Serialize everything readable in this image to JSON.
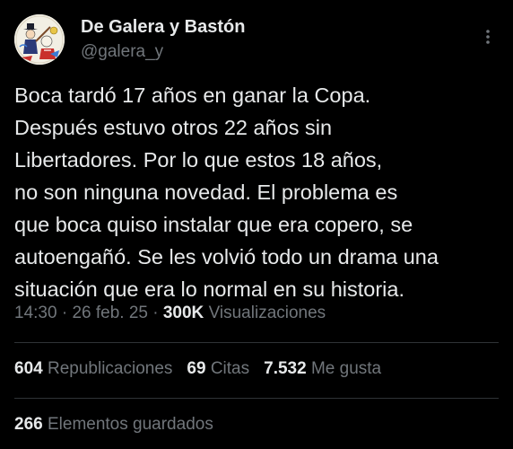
{
  "author": {
    "display_name": "De Galera y Bastón",
    "handle": "@galera_y",
    "avatar_icon": "cartoon-avatar-icon"
  },
  "more_icon": "more-vertical-icon",
  "tweet": {
    "lines": [
      "Boca tardó 17 años en ganar la Copa.",
      "Después estuvo otros 22 años sin",
      "Libertadores. Por lo que estos 18 años,",
      "no son ninguna novedad. El problema es",
      "que boca quiso instalar que era copero, se",
      "autoengañó. Se les volvió todo un drama una",
      "situación que era lo normal en su historia."
    ]
  },
  "meta": {
    "time": "14:30",
    "separator": "·",
    "date": "26 feb. 25",
    "views_count": "300K",
    "views_label": "Visualizaciones"
  },
  "stats": {
    "reposts_count": "604",
    "reposts_label": "Republicaciones",
    "quotes_count": "69",
    "quotes_label": "Citas",
    "likes_count": "7.532",
    "likes_label": "Me gusta",
    "bookmarks_count": "266",
    "bookmarks_label": "Elementos guardados"
  },
  "colors": {
    "background": "#000000",
    "primary_text": "#e7e9ea",
    "secondary_text": "#71767b",
    "divider": "#2f3336"
  }
}
